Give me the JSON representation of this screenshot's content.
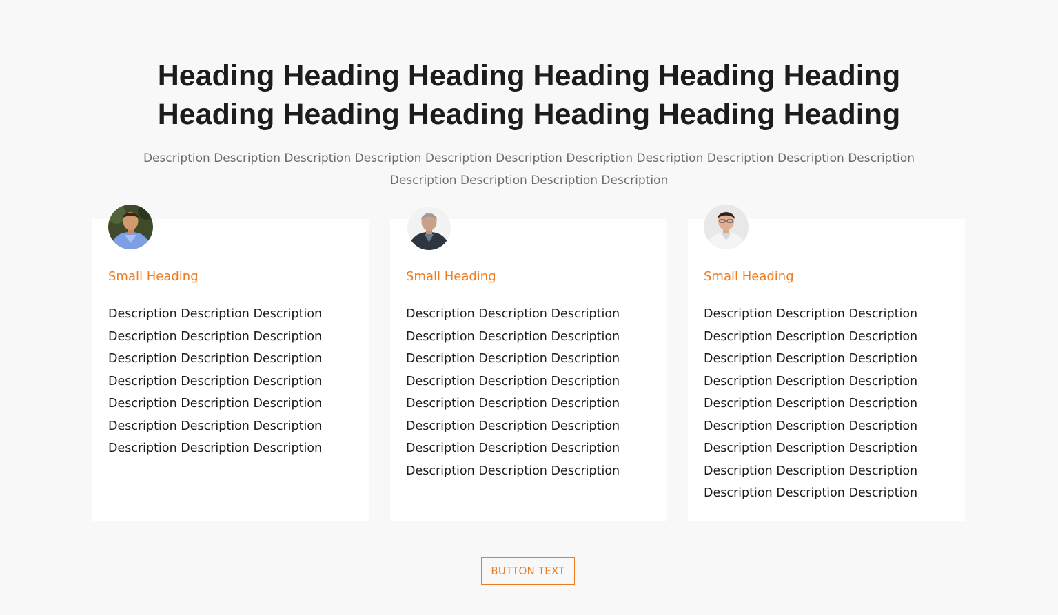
{
  "section": {
    "heading": "Heading Heading Heading Heading Heading Heading Heading Heading Heading Heading Heading Heading",
    "description": "Description Description Description Description Description Description Description Description Description Description Description Description Description Description Description"
  },
  "colors": {
    "accent": "#f07b1d",
    "heading": "#1c1c1c",
    "muted": "#6b6b6b",
    "background": "#f8f8f8",
    "card": "#ffffff"
  },
  "cards": [
    {
      "avatar": "person-photo",
      "heading": "Small Heading",
      "lines": [
        "Description Description Description",
        "Description Description Description",
        "Description Description Description",
        "Description Description Description",
        "Description Description Description",
        "Description Description Description",
        "Description Description Description"
      ]
    },
    {
      "avatar": "person-photo",
      "heading": "Small Heading",
      "lines": [
        "Description Description Description",
        "Description Description Description",
        "Description Description Description",
        "Description Description Description",
        "Description Description Description",
        "Description Description Description",
        "Description Description Description",
        "Description Description Description"
      ]
    },
    {
      "avatar": "person-photo",
      "heading": "Small Heading",
      "lines": [
        "Description Description Description",
        "Description Description Description",
        "Description Description Description",
        "Description Description Description",
        "Description Description Description",
        "Description Description Description",
        "Description Description Description",
        "Description Description Description",
        "Description Description Description"
      ]
    }
  ],
  "button": {
    "label": "BUTTON TEXT"
  }
}
